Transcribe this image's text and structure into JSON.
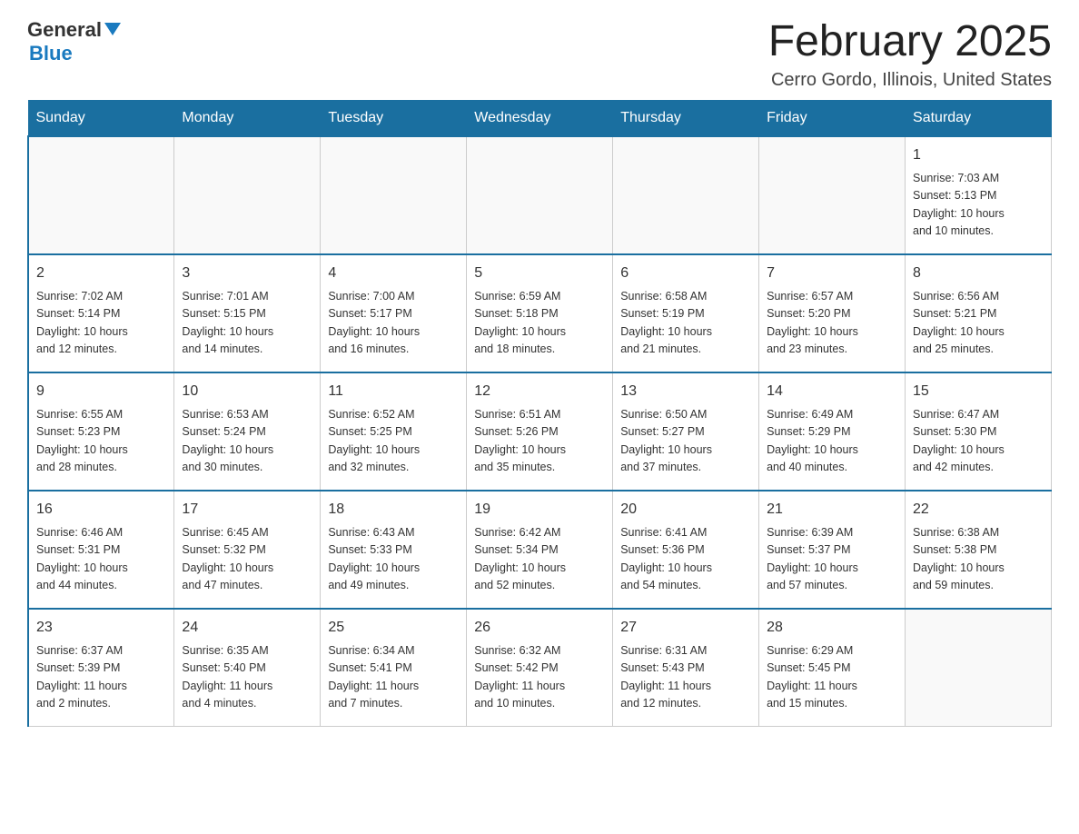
{
  "header": {
    "logo_general": "General",
    "logo_blue": "Blue",
    "month_title": "February 2025",
    "location": "Cerro Gordo, Illinois, United States"
  },
  "weekdays": [
    "Sunday",
    "Monday",
    "Tuesday",
    "Wednesday",
    "Thursday",
    "Friday",
    "Saturday"
  ],
  "weeks": [
    [
      {
        "day": "",
        "info": ""
      },
      {
        "day": "",
        "info": ""
      },
      {
        "day": "",
        "info": ""
      },
      {
        "day": "",
        "info": ""
      },
      {
        "day": "",
        "info": ""
      },
      {
        "day": "",
        "info": ""
      },
      {
        "day": "1",
        "info": "Sunrise: 7:03 AM\nSunset: 5:13 PM\nDaylight: 10 hours\nand 10 minutes."
      }
    ],
    [
      {
        "day": "2",
        "info": "Sunrise: 7:02 AM\nSunset: 5:14 PM\nDaylight: 10 hours\nand 12 minutes."
      },
      {
        "day": "3",
        "info": "Sunrise: 7:01 AM\nSunset: 5:15 PM\nDaylight: 10 hours\nand 14 minutes."
      },
      {
        "day": "4",
        "info": "Sunrise: 7:00 AM\nSunset: 5:17 PM\nDaylight: 10 hours\nand 16 minutes."
      },
      {
        "day": "5",
        "info": "Sunrise: 6:59 AM\nSunset: 5:18 PM\nDaylight: 10 hours\nand 18 minutes."
      },
      {
        "day": "6",
        "info": "Sunrise: 6:58 AM\nSunset: 5:19 PM\nDaylight: 10 hours\nand 21 minutes."
      },
      {
        "day": "7",
        "info": "Sunrise: 6:57 AM\nSunset: 5:20 PM\nDaylight: 10 hours\nand 23 minutes."
      },
      {
        "day": "8",
        "info": "Sunrise: 6:56 AM\nSunset: 5:21 PM\nDaylight: 10 hours\nand 25 minutes."
      }
    ],
    [
      {
        "day": "9",
        "info": "Sunrise: 6:55 AM\nSunset: 5:23 PM\nDaylight: 10 hours\nand 28 minutes."
      },
      {
        "day": "10",
        "info": "Sunrise: 6:53 AM\nSunset: 5:24 PM\nDaylight: 10 hours\nand 30 minutes."
      },
      {
        "day": "11",
        "info": "Sunrise: 6:52 AM\nSunset: 5:25 PM\nDaylight: 10 hours\nand 32 minutes."
      },
      {
        "day": "12",
        "info": "Sunrise: 6:51 AM\nSunset: 5:26 PM\nDaylight: 10 hours\nand 35 minutes."
      },
      {
        "day": "13",
        "info": "Sunrise: 6:50 AM\nSunset: 5:27 PM\nDaylight: 10 hours\nand 37 minutes."
      },
      {
        "day": "14",
        "info": "Sunrise: 6:49 AM\nSunset: 5:29 PM\nDaylight: 10 hours\nand 40 minutes."
      },
      {
        "day": "15",
        "info": "Sunrise: 6:47 AM\nSunset: 5:30 PM\nDaylight: 10 hours\nand 42 minutes."
      }
    ],
    [
      {
        "day": "16",
        "info": "Sunrise: 6:46 AM\nSunset: 5:31 PM\nDaylight: 10 hours\nand 44 minutes."
      },
      {
        "day": "17",
        "info": "Sunrise: 6:45 AM\nSunset: 5:32 PM\nDaylight: 10 hours\nand 47 minutes."
      },
      {
        "day": "18",
        "info": "Sunrise: 6:43 AM\nSunset: 5:33 PM\nDaylight: 10 hours\nand 49 minutes."
      },
      {
        "day": "19",
        "info": "Sunrise: 6:42 AM\nSunset: 5:34 PM\nDaylight: 10 hours\nand 52 minutes."
      },
      {
        "day": "20",
        "info": "Sunrise: 6:41 AM\nSunset: 5:36 PM\nDaylight: 10 hours\nand 54 minutes."
      },
      {
        "day": "21",
        "info": "Sunrise: 6:39 AM\nSunset: 5:37 PM\nDaylight: 10 hours\nand 57 minutes."
      },
      {
        "day": "22",
        "info": "Sunrise: 6:38 AM\nSunset: 5:38 PM\nDaylight: 10 hours\nand 59 minutes."
      }
    ],
    [
      {
        "day": "23",
        "info": "Sunrise: 6:37 AM\nSunset: 5:39 PM\nDaylight: 11 hours\nand 2 minutes."
      },
      {
        "day": "24",
        "info": "Sunrise: 6:35 AM\nSunset: 5:40 PM\nDaylight: 11 hours\nand 4 minutes."
      },
      {
        "day": "25",
        "info": "Sunrise: 6:34 AM\nSunset: 5:41 PM\nDaylight: 11 hours\nand 7 minutes."
      },
      {
        "day": "26",
        "info": "Sunrise: 6:32 AM\nSunset: 5:42 PM\nDaylight: 11 hours\nand 10 minutes."
      },
      {
        "day": "27",
        "info": "Sunrise: 6:31 AM\nSunset: 5:43 PM\nDaylight: 11 hours\nand 12 minutes."
      },
      {
        "day": "28",
        "info": "Sunrise: 6:29 AM\nSunset: 5:45 PM\nDaylight: 11 hours\nand 15 minutes."
      },
      {
        "day": "",
        "info": ""
      }
    ]
  ]
}
